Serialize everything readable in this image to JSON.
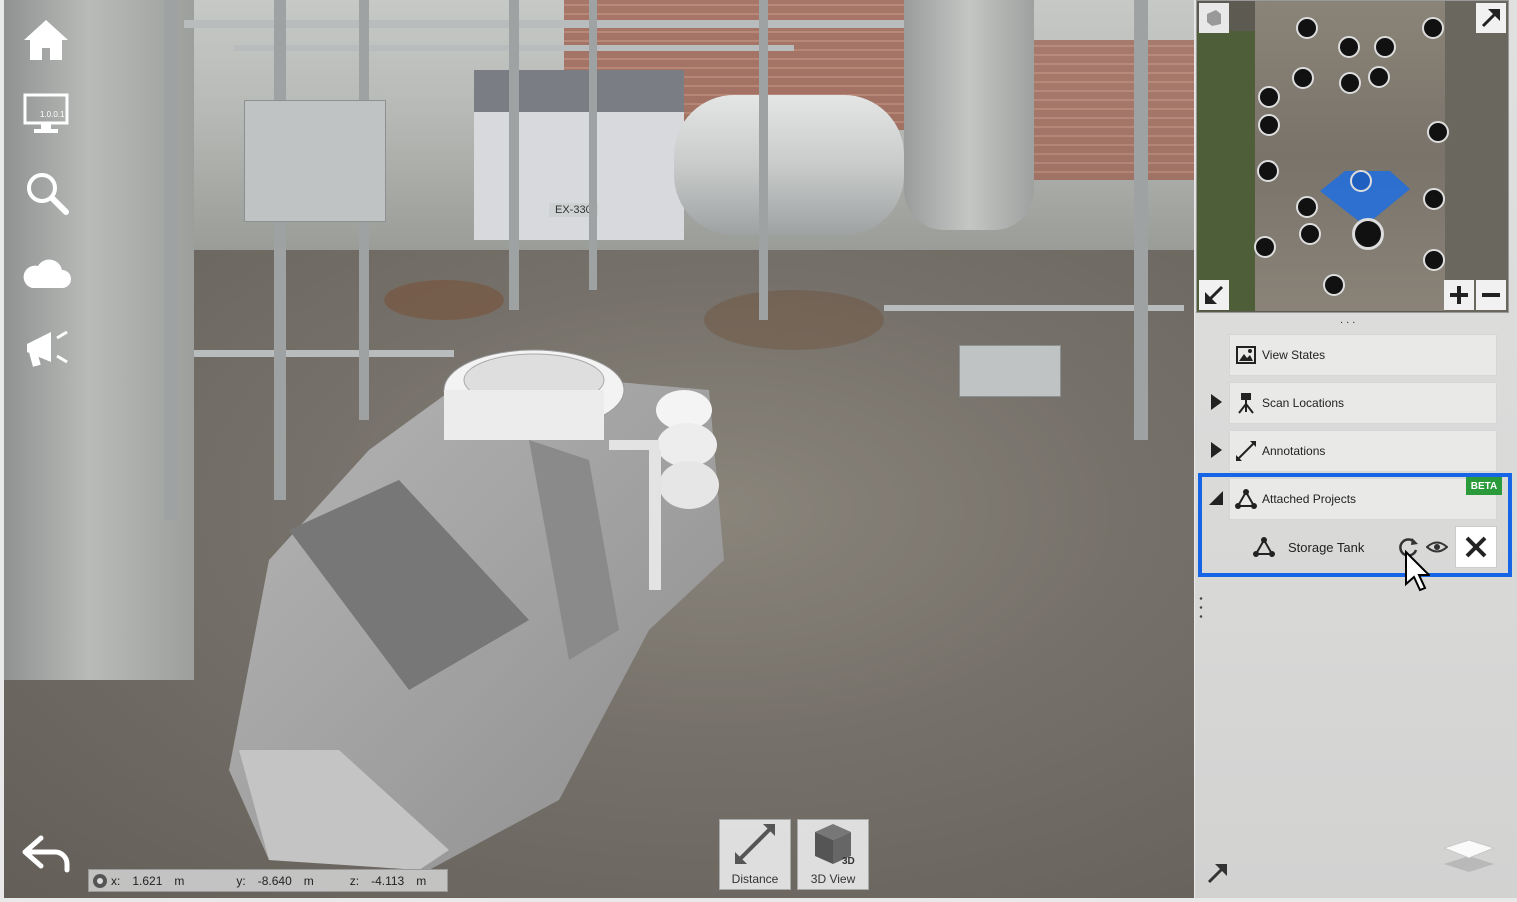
{
  "viewport": {
    "coords": {
      "x_label": "x:",
      "x_value": "1.621",
      "y_label": "y:",
      "y_value": "-8.640",
      "z_label": "z:",
      "z_value": "-4.113",
      "unit": "m"
    },
    "monitor_badge": "1.0.0.1",
    "scene_label": "EX-330"
  },
  "left_toolbar": {
    "icons": [
      "home-icon",
      "monitor-icon",
      "search-icon",
      "cloud-icon",
      "megaphone-icon",
      "back-arrow-icon"
    ]
  },
  "bottom_tools": {
    "distance_label": "Distance",
    "view3d_label": "3D View",
    "view3d_badge": "3D"
  },
  "panel": {
    "rows": [
      {
        "label": "View States"
      },
      {
        "label": "Scan Locations"
      },
      {
        "label": "Annotations"
      },
      {
        "label": "Attached Projects"
      }
    ],
    "beta_badge": "BETA",
    "attached_item": {
      "label": "Storage Tank"
    },
    "handle_dots": ". . ."
  },
  "colors": {
    "highlight": "#1565e6",
    "beta": "#2a9a3a",
    "minimap_view_cone": "#1f6fe0"
  }
}
